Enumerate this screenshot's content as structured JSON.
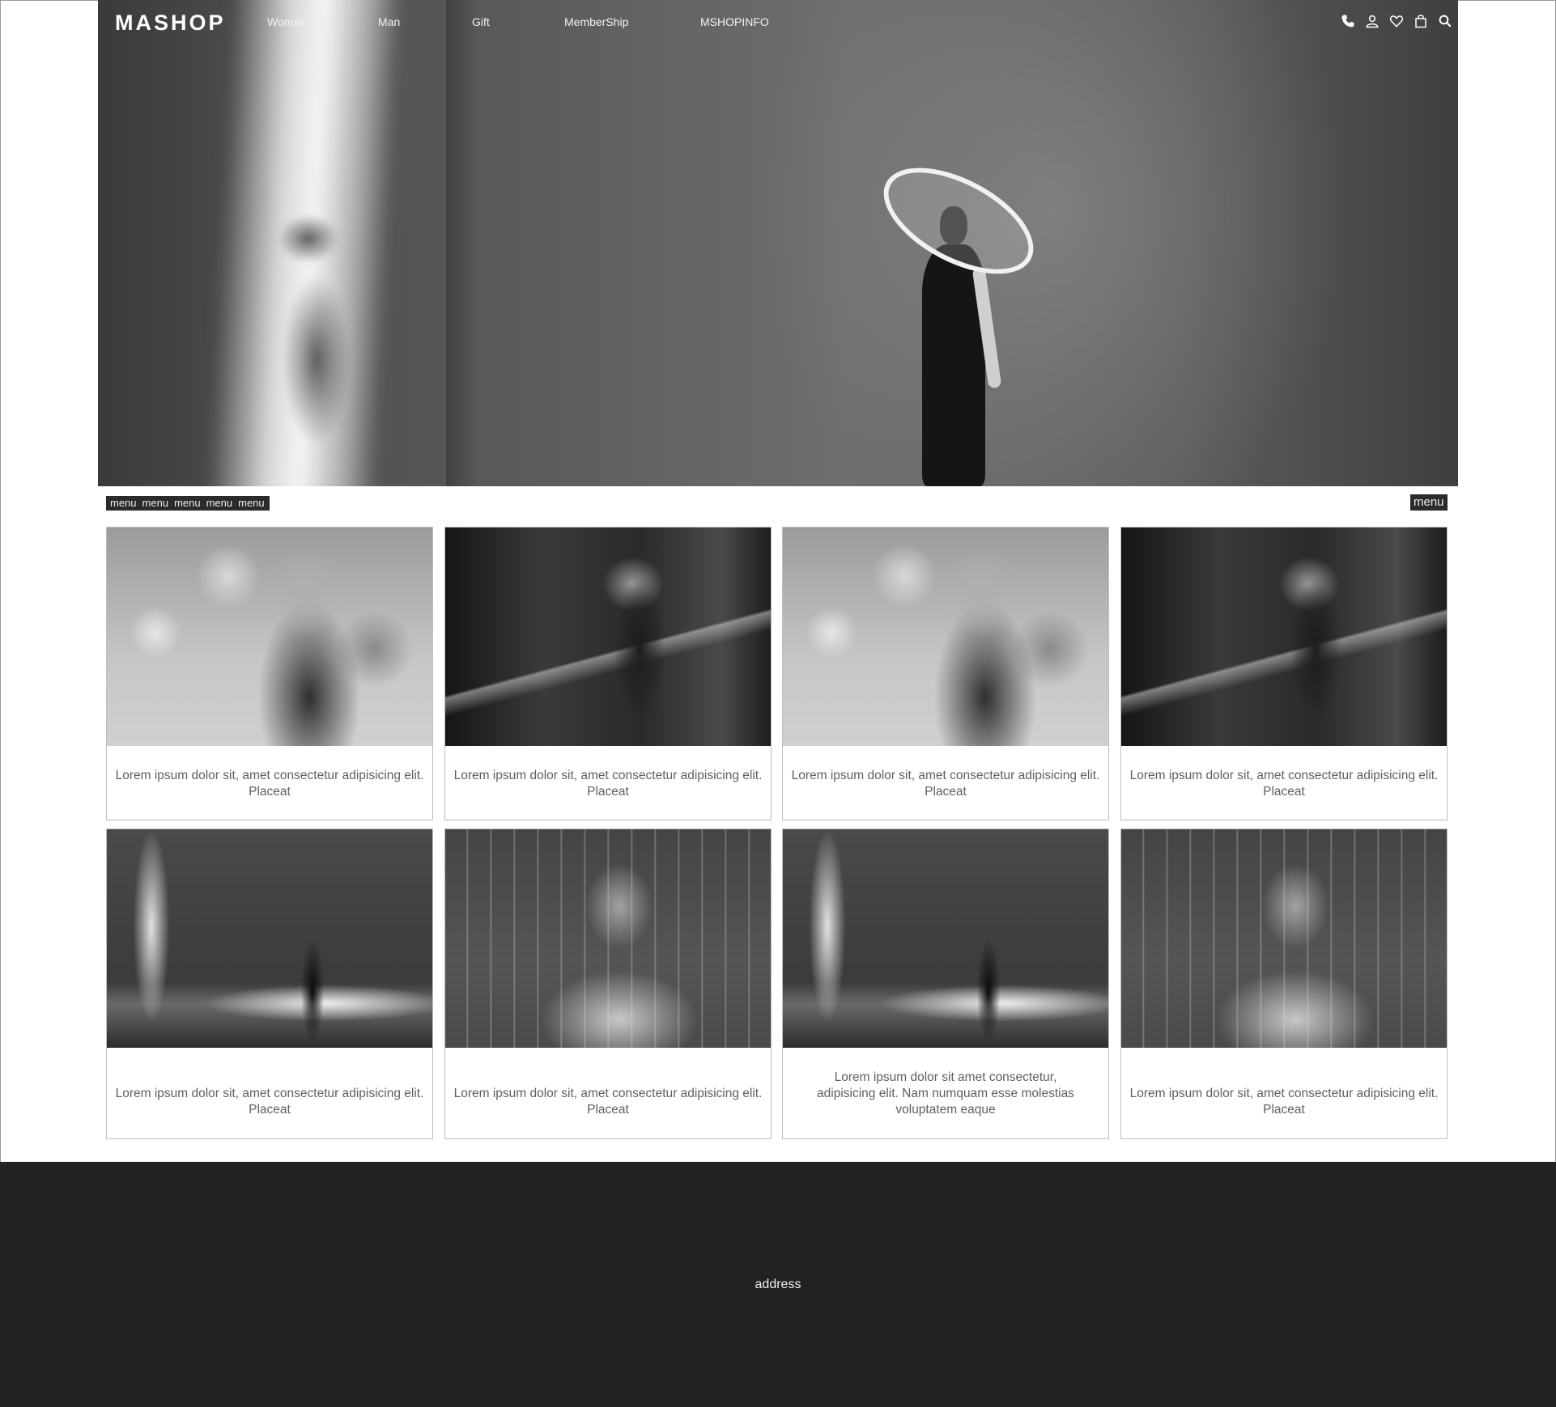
{
  "header": {
    "logo": "MASHOP",
    "nav": [
      {
        "label": "Woman"
      },
      {
        "label": "Man"
      },
      {
        "label": "Gift"
      },
      {
        "label": "MemberShip"
      },
      {
        "label": "MSHOPINFO"
      }
    ],
    "icons": [
      "phone-icon",
      "user-icon",
      "heart-icon",
      "bag-icon",
      "search-icon"
    ]
  },
  "menubar": {
    "left_items": [
      "menu",
      "menu",
      "menu",
      "menu",
      "menu"
    ],
    "right_item": "menu"
  },
  "products": [
    {
      "image": "woman-fur-hood-snow",
      "caption": "Lorem ipsum dolor sit, amet consectetur adipisicing elit. Placeat"
    },
    {
      "image": "woman-sitting-forest",
      "caption": "Lorem ipsum dolor sit, amet consectetur adipisicing elit. Placeat"
    },
    {
      "image": "woman-fur-hood-snow",
      "caption": "Lorem ipsum dolor sit, amet consectetur adipisicing elit. Placeat"
    },
    {
      "image": "woman-sitting-forest",
      "caption": "Lorem ipsum dolor sit, amet consectetur adipisicing elit. Placeat"
    },
    {
      "image": "woman-hat-hallway-light",
      "caption": "Lorem ipsum dolor sit, amet consectetur adipisicing elit. Placeat"
    },
    {
      "image": "woman-rain-jacket",
      "caption": "Lorem ipsum dolor sit, amet consectetur adipisicing elit. Placeat"
    },
    {
      "image": "woman-hat-hallway-light",
      "caption": "Lorem ipsum dolor sit amet consectetur, adipisicing elit. Nam numquam esse molestias voluptatem eaque"
    },
    {
      "image": "woman-rain-jacket",
      "caption": "Lorem ipsum dolor sit, amet consectetur adipisicing elit. Placeat"
    }
  ],
  "footer": {
    "address": "address"
  },
  "colors": {
    "footer_bg": "#222222",
    "menu_bg": "#2b2b2b",
    "caption_text": "#5f5f5f"
  }
}
